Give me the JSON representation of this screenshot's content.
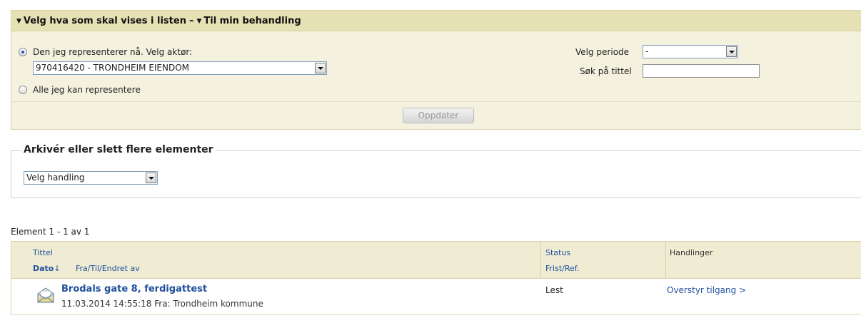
{
  "filter": {
    "header_part1": "Velg hva som skal vises i listen",
    "header_sep": "–",
    "header_part2": "Til min behandling",
    "radio_current_label": "Den jeg representerer nå. Velg aktør:",
    "actor_selected": "970416420 - TRONDHEIM EIENDOM",
    "radio_all_label": "Alle jeg kan representere",
    "period_label": "Velg periode",
    "period_selected": "-",
    "search_label": "Søk på tittel",
    "search_value": "",
    "update_button": "Oppdater"
  },
  "archive": {
    "title": "Arkivér eller slett flere elementer",
    "action_selected": "Velg handling"
  },
  "list": {
    "count_text": "Element 1 - 1 av 1",
    "headers": {
      "title": "Tittel",
      "date": "Dato",
      "date_sort_icon": "↓",
      "from": "Fra/Til/Endret av",
      "status": "Status",
      "deadline": "Frist/Ref.",
      "actions": "Handlinger"
    },
    "rows": [
      {
        "icon": "open-envelope-icon",
        "title": "Brodals gate 8, ferdigattest",
        "meta": "11.03.2014 14:55:18 Fra: Trondheim kommune",
        "status": "Lest",
        "action": "Overstyr tilgang >"
      }
    ]
  },
  "colors": {
    "panel_bg": "#f4f2df",
    "header_bg": "#e6e1b4",
    "link": "#1f4f9c"
  }
}
